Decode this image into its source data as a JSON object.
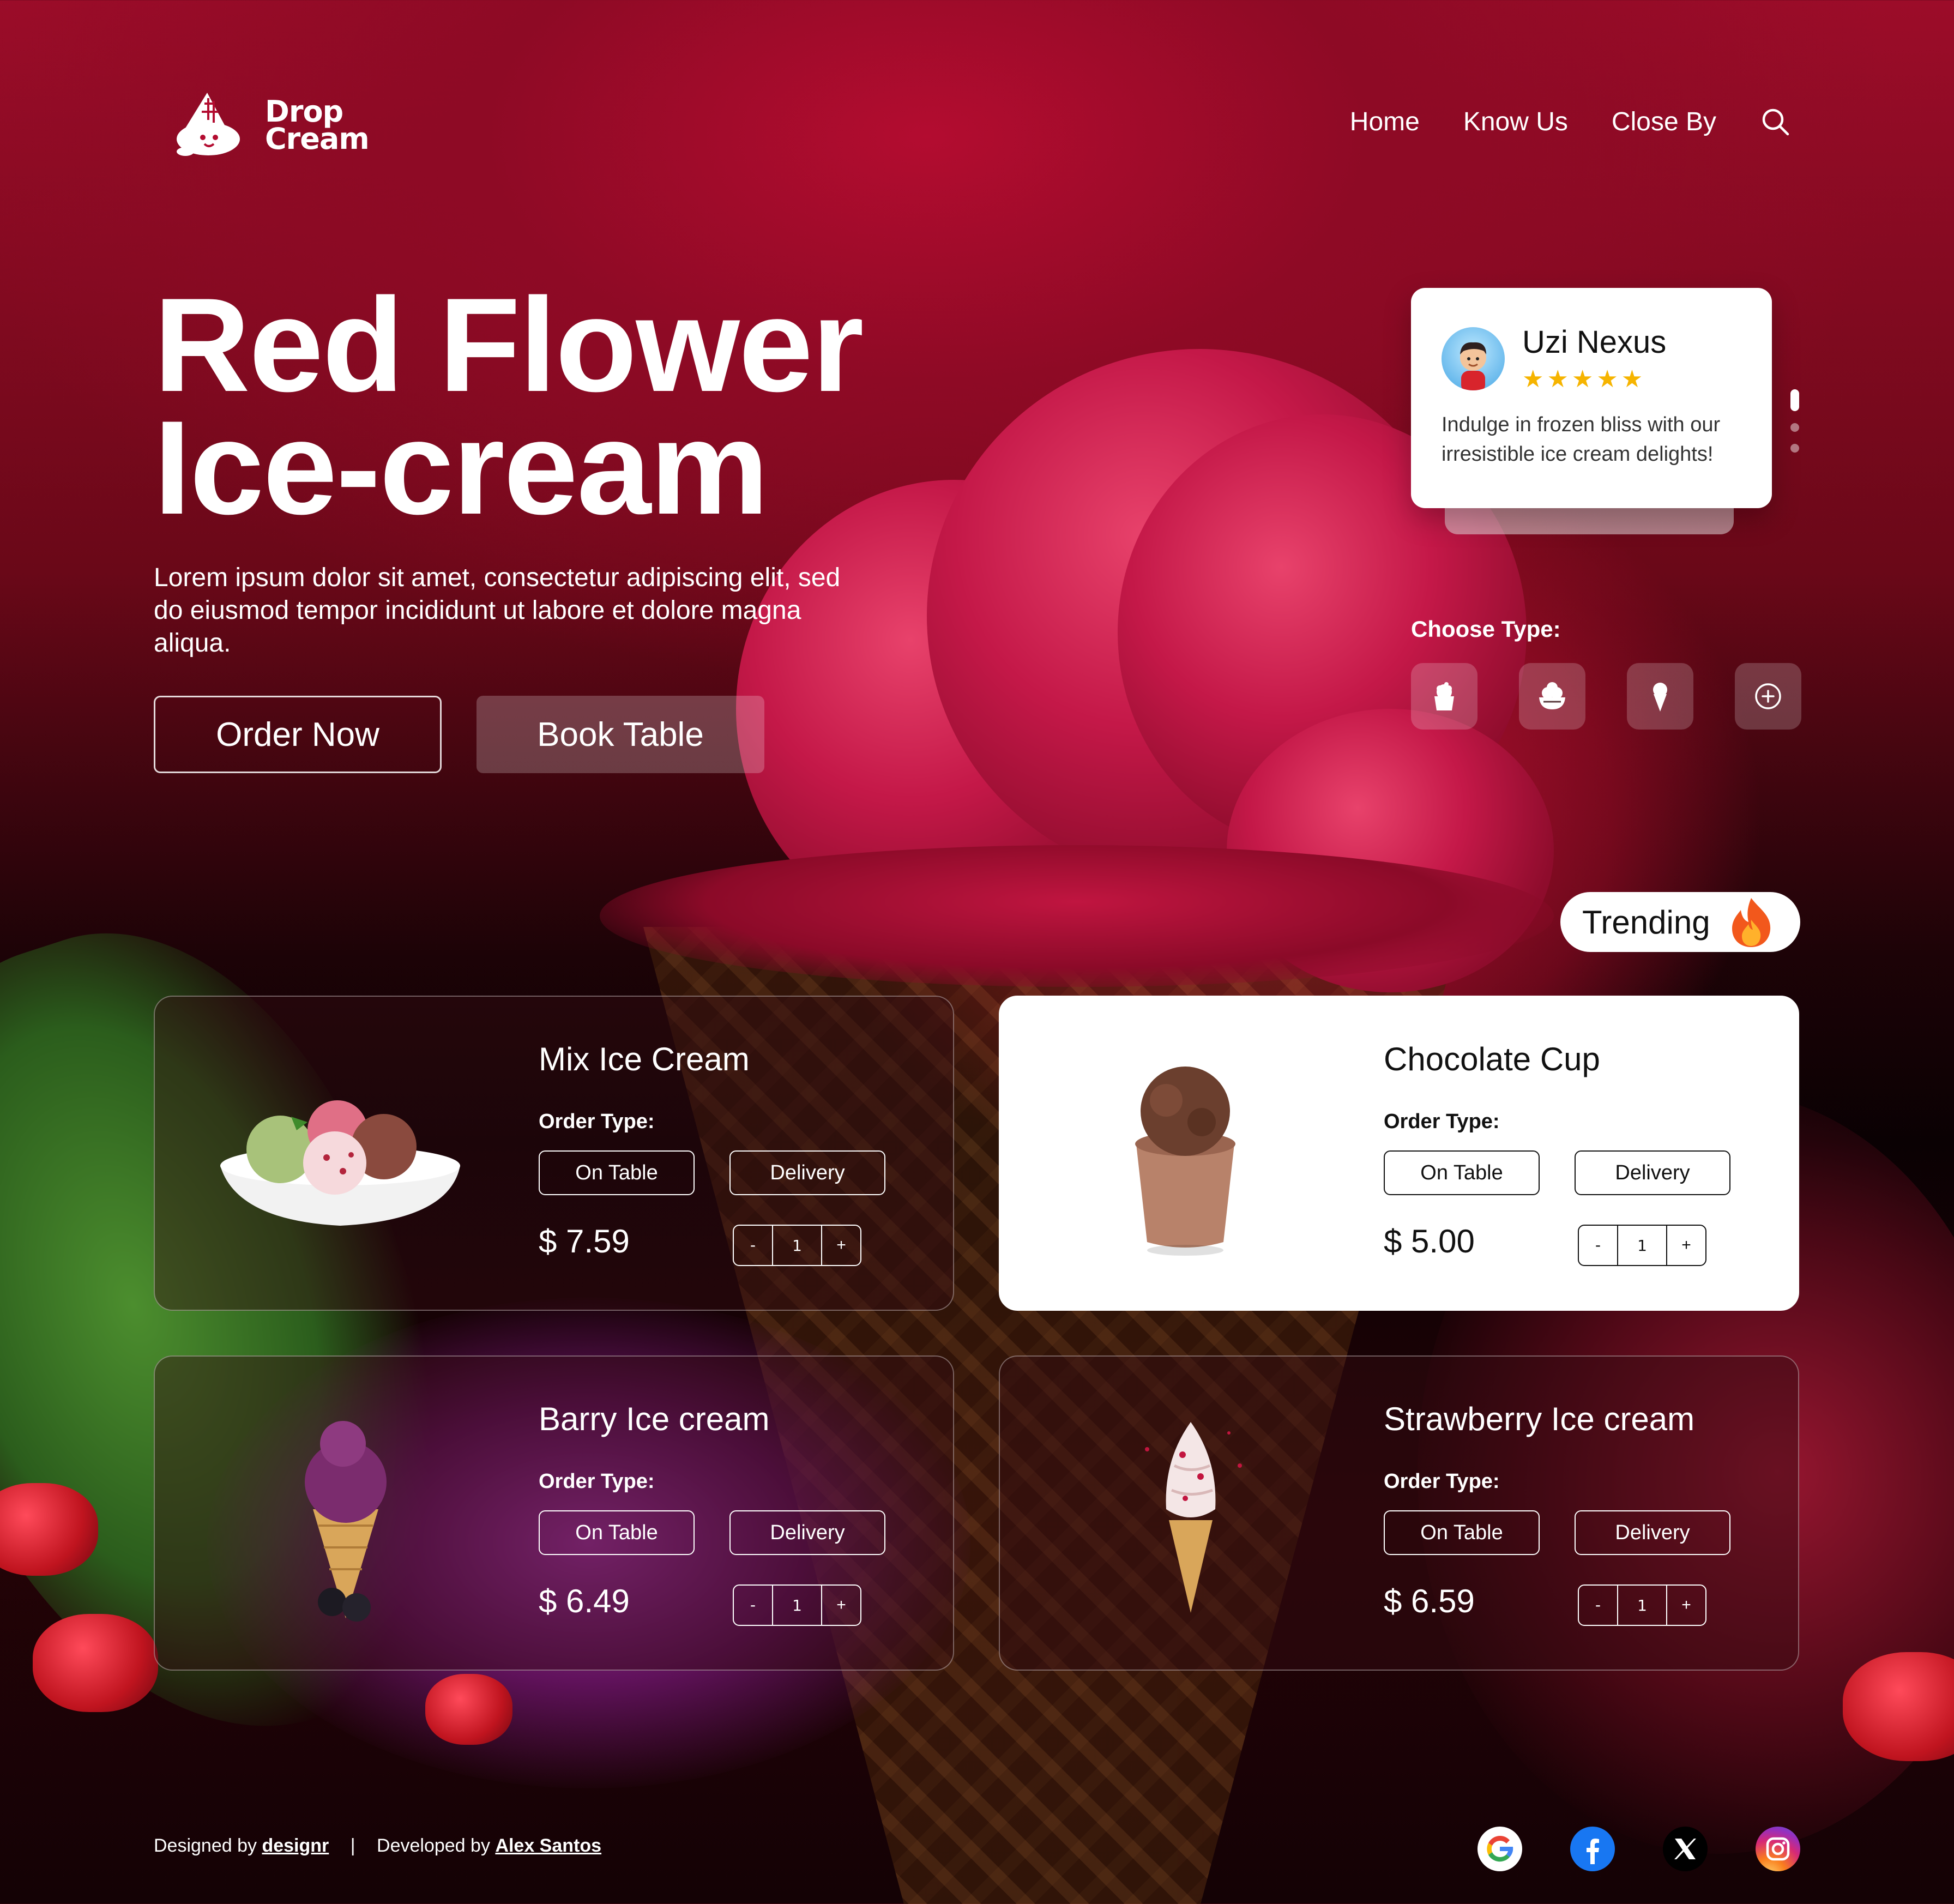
{
  "brand": {
    "line1": "Drop",
    "line2": "Cream"
  },
  "nav": {
    "items": [
      "Home",
      "Know Us",
      "Close By"
    ]
  },
  "hero": {
    "title_line1": "Red Flower",
    "title_line2": "Ice-cream",
    "description": "Lorem ipsum dolor sit amet, consectetur adipiscing elit, sed do eiusmod tempor incididunt ut labore et dolore magna aliqua.",
    "order_label": "Order Now",
    "book_label": "Book Table"
  },
  "review": {
    "name": "Uzi Nexus",
    "rating": 4.5,
    "stars": "★★★★★",
    "text": "Indulge in frozen bliss with our irresistible ice cream delights!"
  },
  "choose_type": {
    "label": "Choose Type:",
    "icons": [
      "cup-icon",
      "bowl-icon",
      "cone-icon",
      "add-icon"
    ]
  },
  "trending": {
    "label": "Trending"
  },
  "products": [
    {
      "title": "Mix Ice Cream",
      "order_type_label": "Order Type:",
      "option_a": "On Table",
      "option_b": "Delivery",
      "price": "$ 7.59",
      "minus": "-",
      "qty": "1",
      "plus": "+"
    },
    {
      "title": "Chocolate Cup",
      "order_type_label": "Order Type:",
      "option_a": "On Table",
      "option_b": "Delivery",
      "price": "$ 5.00",
      "minus": "-",
      "qty": "1",
      "plus": "+"
    },
    {
      "title": "Barry Ice cream",
      "order_type_label": "Order Type:",
      "option_a": "On Table",
      "option_b": "Delivery",
      "price": "$ 6.49",
      "minus": "-",
      "qty": "1",
      "plus": "+"
    },
    {
      "title": "Strawberry Ice cream",
      "order_type_label": "Order Type:",
      "option_a": "On Table",
      "option_b": "Delivery",
      "price": "$ 6.59",
      "minus": "-",
      "qty": "1",
      "plus": "+"
    }
  ],
  "footer": {
    "designed_by": "Designed by",
    "designer": "designr",
    "separator": "|",
    "developed_by": "Developed by",
    "developer": "Alex Santos"
  },
  "socials": [
    "google-icon",
    "facebook-icon",
    "x-icon",
    "instagram-icon"
  ],
  "colors": {
    "accent": "#b30c30",
    "star": "#f6b400",
    "card_dark": "#320a12",
    "card_light": "#ffffff"
  }
}
